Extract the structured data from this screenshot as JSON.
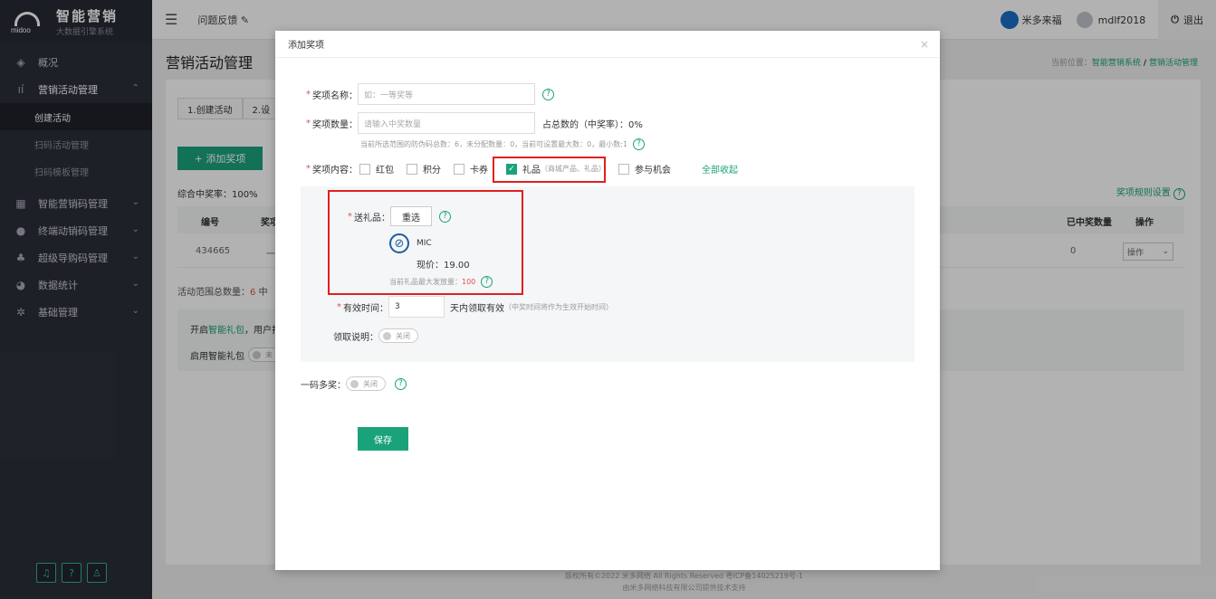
{
  "app": {
    "logo_title": "智能营销",
    "logo_sub": "大数据引擎系统",
    "logo_mark": "midoo"
  },
  "sidebar": {
    "items": [
      {
        "label": "概况",
        "icon": "layers-icon"
      },
      {
        "label": "营销活动管理",
        "icon": "chart-icon"
      },
      {
        "label": "智能营销码管理",
        "icon": "qrcode-icon"
      },
      {
        "label": "终端动销码管理",
        "icon": "shop-icon"
      },
      {
        "label": "超级导购码管理",
        "icon": "people-icon"
      },
      {
        "label": "数据统计",
        "icon": "pie-icon"
      },
      {
        "label": "基础管理",
        "icon": "gear-icon"
      }
    ],
    "sub_items": [
      "创建活动",
      "扫码活动管理",
      "扫码模板管理"
    ]
  },
  "topbar": {
    "feedback": "问题反馈",
    "brand_user": "米多来福",
    "username": "mdlf2018",
    "logout": "退出"
  },
  "page": {
    "title": "营销活动管理",
    "crumb_prefix": "当前位置：",
    "crumb_1": "智能营销系统",
    "crumb_sep": "/",
    "crumb_2": "营销活动管理",
    "step1": "1.创建活动",
    "step2": "2.设",
    "add_button": "+ 添加奖项",
    "rate": "综合中奖率：100%",
    "rule_link": "奖项规则设置",
    "columns": {
      "id": "编号",
      "prize": "奖项",
      "won": "已中奖数量",
      "op": "操作"
    },
    "row": {
      "id": "434665",
      "prize": "一",
      "won": "0",
      "op": "操作"
    },
    "range_label": "活动范围总数量：",
    "range_value": "6",
    "range_tail": "中",
    "smart_line1_a": "开启",
    "smart_line1_link": "智能礼包",
    "smart_line1_b": "，用户扫",
    "smart_line2": "启用智能礼包",
    "smart_toggle": "未",
    "footer_1": "版权所有©2022 米多网络 All Rights Reserved 粤ICP备14025219号-1",
    "footer_2": "由米多网络科技有限公司提供技术支持"
  },
  "modal": {
    "title": "添加奖项",
    "name_label": "奖项名称：",
    "name_placeholder": "如：一等奖等",
    "qty_label": "奖项数量：",
    "qty_placeholder": "请输入中奖数量",
    "ratio_text": "占总数的（中奖率）：0%",
    "qty_hint": "当前所选范围的防伪码总数：6，未分配数量：0，当前可设置最大数：0，最小数:1",
    "content_label": "奖项内容：",
    "opts": [
      "红包",
      "积分",
      "卡券",
      "礼品",
      "参与机会"
    ],
    "gift_sub": "（商城产品、礼品）",
    "collapse_all": "全部收起",
    "send_gift_label": "送礼品：",
    "reselect": "重选",
    "product_name": "MIC",
    "price": "现价：19.00",
    "max_label": "当前礼品最大发放量：",
    "max_value": "100",
    "valid_label": "有效时间：",
    "valid_value": "3",
    "valid_text": "天内领取有效",
    "valid_hint": "（中奖时间将作为生效开始时间）",
    "claim_label": "领取说明：",
    "toggle_off": "关闭",
    "multi_label": "一码多奖：",
    "save": "保存"
  }
}
